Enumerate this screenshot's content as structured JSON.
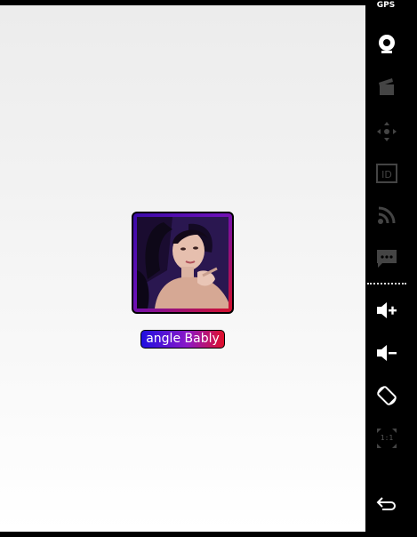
{
  "app": {
    "profile": {
      "name": "angle Bably",
      "photo_alt": "profile photo"
    }
  },
  "emulator_controls": {
    "gps_label": "GPS",
    "scale_label": "1:1",
    "items": [
      {
        "name": "gps",
        "icon": "gps-icon"
      },
      {
        "name": "camera",
        "icon": "webcam-icon"
      },
      {
        "name": "media",
        "icon": "clapperboard-icon"
      },
      {
        "name": "dpad",
        "icon": "move-icon"
      },
      {
        "name": "identity",
        "icon": "id-icon"
      },
      {
        "name": "network",
        "icon": "rss-icon"
      },
      {
        "name": "sms",
        "icon": "message-icon"
      },
      {
        "name": "volume-up",
        "icon": "volume-up-icon"
      },
      {
        "name": "volume-down",
        "icon": "volume-down-icon"
      },
      {
        "name": "rotate",
        "icon": "rotate-icon"
      },
      {
        "name": "scale",
        "icon": "scale-icon"
      },
      {
        "name": "back",
        "icon": "back-icon"
      }
    ]
  },
  "colors": {
    "badge_start": "#2010e0",
    "badge_end": "#e0102a",
    "sidebar_bg": "#000000",
    "icon_active": "#ffffff",
    "icon_disabled": "#444444"
  }
}
